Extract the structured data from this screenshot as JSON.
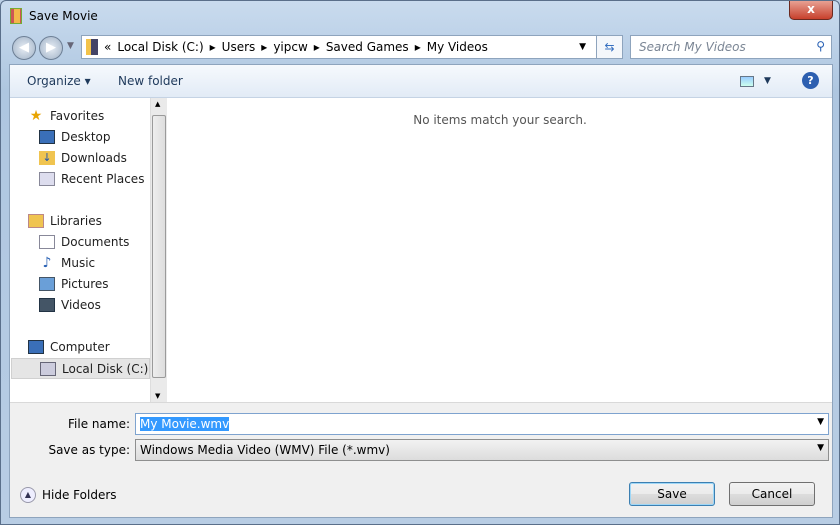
{
  "window": {
    "title": "Save Movie",
    "close_label": "x"
  },
  "address": {
    "overflow": "«",
    "crumbs": [
      "Local Disk (C:)",
      "Users",
      "yipcw",
      "Saved Games",
      "My Videos"
    ],
    "separator": "▸"
  },
  "search": {
    "placeholder": "Search My Videos"
  },
  "toolbar": {
    "organize": "Organize ▾",
    "new_folder": "New folder"
  },
  "nav": {
    "favorites": "Favorites",
    "desktop": "Desktop",
    "downloads": "Downloads",
    "recent": "Recent Places",
    "libraries": "Libraries",
    "documents": "Documents",
    "music": "Music",
    "pictures": "Pictures",
    "videos": "Videos",
    "computer": "Computer",
    "local_disk": "Local Disk (C:)"
  },
  "content": {
    "empty_message": "No items match your search."
  },
  "form": {
    "file_name_label": "File name:",
    "file_name_value": "My Movie.wmv",
    "type_label": "Save as type:",
    "type_value": "Windows Media Video (WMV) File (*.wmv)"
  },
  "buttons": {
    "save": "Save",
    "cancel": "Cancel",
    "hide_folders": "Hide Folders"
  }
}
